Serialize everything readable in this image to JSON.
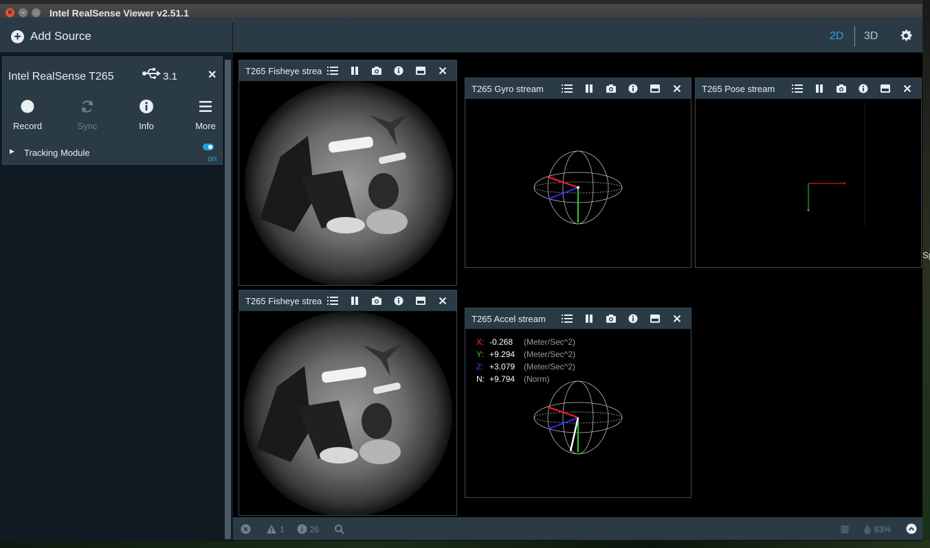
{
  "window": {
    "title": "Intel RealSense Viewer v2.51.1"
  },
  "topbar": {
    "add_source_label": "Add Source",
    "view_2d": "2D",
    "view_3d": "3D",
    "active_view": "2D",
    "accent_color": "#1aa3e6"
  },
  "device": {
    "name": "Intel RealSense T265",
    "usb_version": "3.1",
    "buttons": [
      {
        "label": "Record",
        "icon": "record-icon",
        "enabled": true
      },
      {
        "label": "Sync",
        "icon": "sync-icon",
        "enabled": false
      },
      {
        "label": "Info",
        "icon": "info-icon",
        "enabled": true
      },
      {
        "label": "More",
        "icon": "menu-icon",
        "enabled": true
      }
    ],
    "module": {
      "label": "Tracking Module",
      "state": "on"
    }
  },
  "streams": {
    "fisheye1": {
      "title": "T265 Fisheye strea"
    },
    "fisheye2": {
      "title": "T265 Fisheye strea"
    },
    "gyro": {
      "title": "T265 Gyro stream"
    },
    "pose": {
      "title": "T265 Pose stream"
    },
    "accel": {
      "title": "T265 Accel stream",
      "readout": [
        {
          "axis": "X:",
          "value": "-0.268",
          "unit": "(Meter/Sec^2)",
          "color": "#ff2020"
        },
        {
          "axis": "Y:",
          "value": "+9.294",
          "unit": "(Meter/Sec^2)",
          "color": "#20d020"
        },
        {
          "axis": "Z:",
          "value": "+3.079",
          "unit": "(Meter/Sec^2)",
          "color": "#4040ff"
        },
        {
          "axis": "N:",
          "value": "+9.794",
          "unit": "(Norm)",
          "color": "#ffffff"
        }
      ]
    }
  },
  "statusbar": {
    "warnings": "1",
    "info_count": "26",
    "gpu_percent": "63%"
  },
  "desktop": {
    "edge_text": "Sp"
  }
}
